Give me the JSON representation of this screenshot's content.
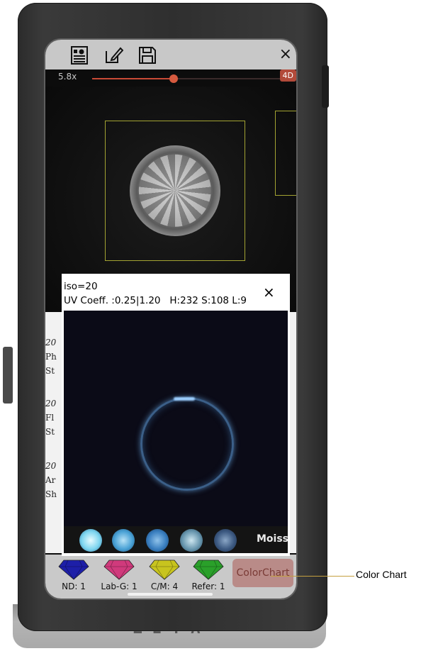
{
  "device": {
    "brand": "ZETA"
  },
  "toolbar": {
    "close_glyph": "×",
    "icons": [
      "report-icon",
      "edit-icon",
      "save-icon"
    ]
  },
  "zoom": {
    "label": "5.8x",
    "value_fraction": 0.43,
    "mode_badge": "4D"
  },
  "popup": {
    "iso_line": "iso=20",
    "uv_line": "UV Coeff. :0.25|1.20   H:232 S:108 L:9",
    "close_glyph": "×",
    "reference_label": "Moiss"
  },
  "underlying_text": [
    "20",
    "Ph",
    "St",
    "20",
    "Fl",
    "St",
    "20",
    "Ar",
    "Sh"
  ],
  "bottom_bar": {
    "gems": [
      {
        "label": "ND: 1",
        "color": "#1d1fa8"
      },
      {
        "label": "Lab-G: 1",
        "color": "#d03a7c"
      },
      {
        "label": "C/M: 4",
        "color": "#c8c41e"
      },
      {
        "label": "Refer: 1",
        "color": "#2aa02a"
      }
    ],
    "color_chart_label": "ColorChart"
  },
  "callout": {
    "label": "Color Chart"
  },
  "colors": {
    "accent": "#c94a36",
    "detect_box": "#a3a332",
    "uv_glow": "#4a77a6"
  }
}
